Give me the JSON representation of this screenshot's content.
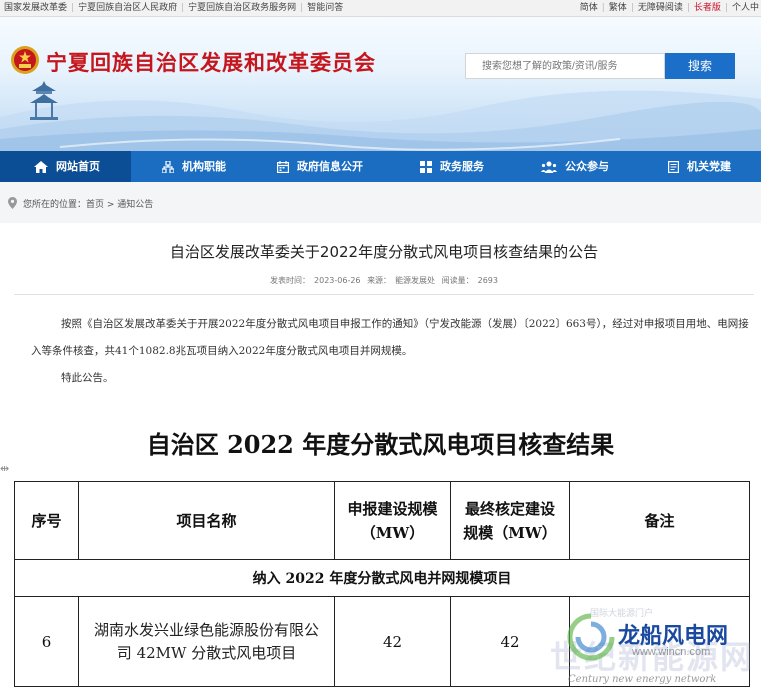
{
  "topbar": {
    "links": [
      "国家发展改革委",
      "宁夏回族自治区人民政府",
      "宁夏回族自治区政务服务网",
      "智能问答"
    ],
    "simplified": "简体",
    "traditional": "繁体",
    "accessible": "无障碍阅读",
    "elder": "长者版",
    "personal": "个人中"
  },
  "header": {
    "site_title": "宁夏回族自治区发展和改革委员会",
    "search_placeholder": "搜索您想了解的政策/资讯/服务",
    "search_button": "搜索"
  },
  "nav": {
    "items": [
      {
        "label": "网站首页",
        "icon": "home-icon"
      },
      {
        "label": "机构职能",
        "icon": "org-chart-icon"
      },
      {
        "label": "政府信息公开",
        "icon": "calendar-icon"
      },
      {
        "label": "政务服务",
        "icon": "grid-icon"
      },
      {
        "label": "公众参与",
        "icon": "people-icon"
      },
      {
        "label": "机关党建",
        "icon": "document-icon"
      }
    ]
  },
  "breadcrumb": {
    "prefix": "您所在的位置：",
    "home": "首页",
    "separator": " > ",
    "current": "通知公告"
  },
  "article": {
    "title": "自治区发展改革委关于2022年度分散式风电项目核查结果的公告",
    "publish_label": "发表时间：",
    "publish_date": "2023-06-26",
    "source_label": "来源：",
    "source": "能源发展处",
    "views_label": "阅读量：",
    "views": "2693",
    "paragraph1": "按照《自治区发展改革委关于开展2022年度分散式风电项目申报工作的通知》（宁发改能源（发展）〔2022〕663号），经过对申报项目用地、电网接入等条件核查，共41个1082.8兆瓦项目纳入2022年度分散式风电项目并网规模。",
    "paragraph2": "特此公告。"
  },
  "result": {
    "title": "自治区 2022 年度分散式风电项目核查结果",
    "headers": {
      "seq": "序号",
      "name": "项目名称",
      "declared": "申报建设规模（MW）",
      "final": "最终核定建设规模（MW）",
      "remark": "备注"
    },
    "section": "纳入 2022 年度分散式风电并网规模项目",
    "rows": [
      {
        "seq": "6",
        "name": "湖南水发兴业绿色能源股份有限公司 42MW 分散式风电项目",
        "declared": "42",
        "final": "42",
        "remark": ""
      }
    ]
  },
  "watermark": {
    "brand": "龙船风电网",
    "big": "世纪新能源网",
    "url": "www.wincn.com",
    "english": "Century new energy network",
    "small": "国际大能源门户"
  },
  "colors": {
    "nav_blue": "#1a6dc1",
    "nav_active": "#0c4e96",
    "title_red": "#c4161c",
    "search_blue": "#1c6fc8"
  }
}
